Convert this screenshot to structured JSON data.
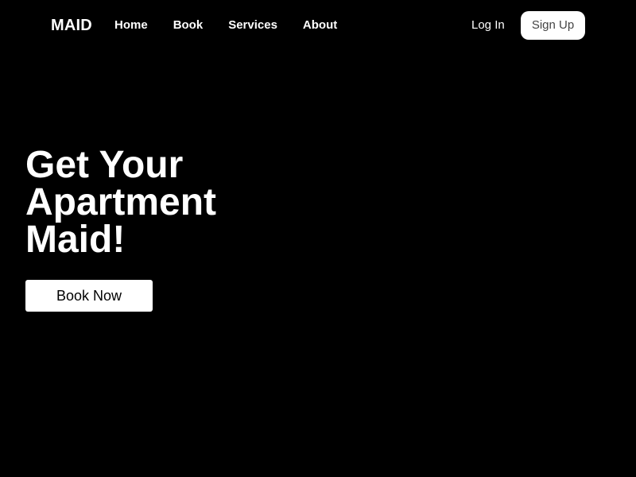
{
  "brand": "MAID",
  "nav": {
    "links": [
      "Home",
      "Book",
      "Services",
      "About"
    ],
    "login_label": "Log In",
    "signup_label": "Sign Up"
  },
  "hero": {
    "title_lines": [
      "Get Your",
      "Apartment",
      "Maid!"
    ],
    "cta_label": "Book Now"
  },
  "colors": {
    "background": "#000000",
    "text": "#ffffff",
    "button_bg": "#ffffff"
  }
}
